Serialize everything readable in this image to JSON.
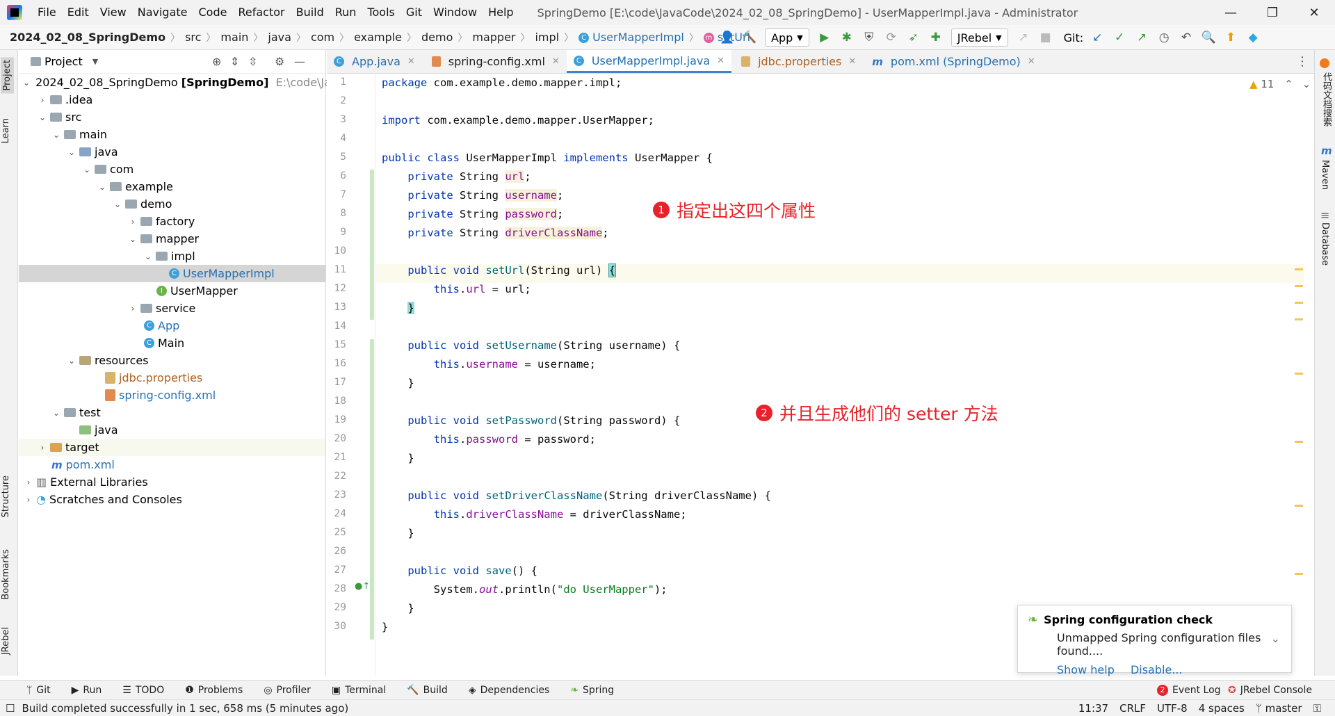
{
  "window": {
    "title": "SpringDemo [E:\\code\\JavaCode\\2024_02_08_SpringDemo] - UserMapperImpl.java - Administrator",
    "menu": [
      "File",
      "Edit",
      "View",
      "Navigate",
      "Code",
      "Refactor",
      "Build",
      "Run",
      "Tools",
      "Git",
      "Window",
      "Help"
    ]
  },
  "breadcrumbs": {
    "project": "2024_02_08_SpringDemo",
    "parts": [
      "src",
      "main",
      "java",
      "com",
      "example",
      "demo",
      "mapper",
      "impl"
    ],
    "class": "UserMapperImpl",
    "method": "setUrl"
  },
  "toolbar": {
    "run_config": "App",
    "jrebel": "JRebel",
    "git_label": "Git:"
  },
  "project_panel": {
    "title": "Project",
    "rows": [
      {
        "label": "2024_02_08_SpringDemo",
        "suffix": "[SpringDemo]",
        "path": "E:\\code\\Java"
      },
      {
        "label": ".idea"
      },
      {
        "label": "src"
      },
      {
        "label": "main"
      },
      {
        "label": "java"
      },
      {
        "label": "com"
      },
      {
        "label": "example"
      },
      {
        "label": "demo"
      },
      {
        "label": "factory"
      },
      {
        "label": "mapper"
      },
      {
        "label": "impl"
      },
      {
        "label": "UserMapperImpl"
      },
      {
        "label": "UserMapper"
      },
      {
        "label": "service"
      },
      {
        "label": "App"
      },
      {
        "label": "Main"
      },
      {
        "label": "resources"
      },
      {
        "label": "jdbc.properties"
      },
      {
        "label": "spring-config.xml"
      },
      {
        "label": "test"
      },
      {
        "label": "java"
      },
      {
        "label": "target"
      },
      {
        "label": "pom.xml"
      },
      {
        "label": "External Libraries"
      },
      {
        "label": "Scratches and Consoles"
      }
    ]
  },
  "tabs": [
    "App.java",
    "spring-config.xml",
    "UserMapperImpl.java",
    "jdbc.properties",
    "pom.xml (SpringDemo)"
  ],
  "left_stripe": [
    "Project",
    "Learn",
    "Structure",
    "Bookmarks",
    "JRebel"
  ],
  "right_stripe": [
    "代码文档搜索",
    "Maven",
    "Database"
  ],
  "editor": {
    "warnings": "11",
    "lines": [
      "1",
      "2",
      "3",
      "4",
      "5",
      "6",
      "7",
      "8",
      "9",
      "10",
      "11",
      "12",
      "13",
      "14",
      "15",
      "16",
      "17",
      "18",
      "19",
      "20",
      "21",
      "22",
      "23",
      "24",
      "25",
      "26",
      "27",
      "28",
      "29",
      "30"
    ]
  },
  "annotations": {
    "a1_num": "1",
    "a1_text": "指定出这四个属性",
    "a2_num": "2",
    "a2_text": "并且生成他们的 setter 方法"
  },
  "notification": {
    "title": "Spring configuration check",
    "body": "Unmapped Spring configuration files found....",
    "link1": "Show help",
    "link2": "Disable..."
  },
  "bottom_tools": [
    "Git",
    "Run",
    "TODO",
    "Problems",
    "Profiler",
    "Terminal",
    "Build",
    "Dependencies",
    "Spring"
  ],
  "bottom_right_tools": {
    "event_log_count": "2",
    "event_log": "Event Log",
    "jrebel_console": "JRebel Console"
  },
  "status": {
    "message": "Build completed successfully in 1 sec, 658 ms (5 minutes ago)",
    "position": "11:37",
    "line_sep": "CRLF",
    "encoding": "UTF-8",
    "indent": "4 spaces",
    "branch": "master"
  },
  "colors": {
    "keyword": "#0033b3",
    "field": "#871094",
    "string": "#067d17",
    "annotation": "#e8222a",
    "accent": "#4083c9"
  }
}
